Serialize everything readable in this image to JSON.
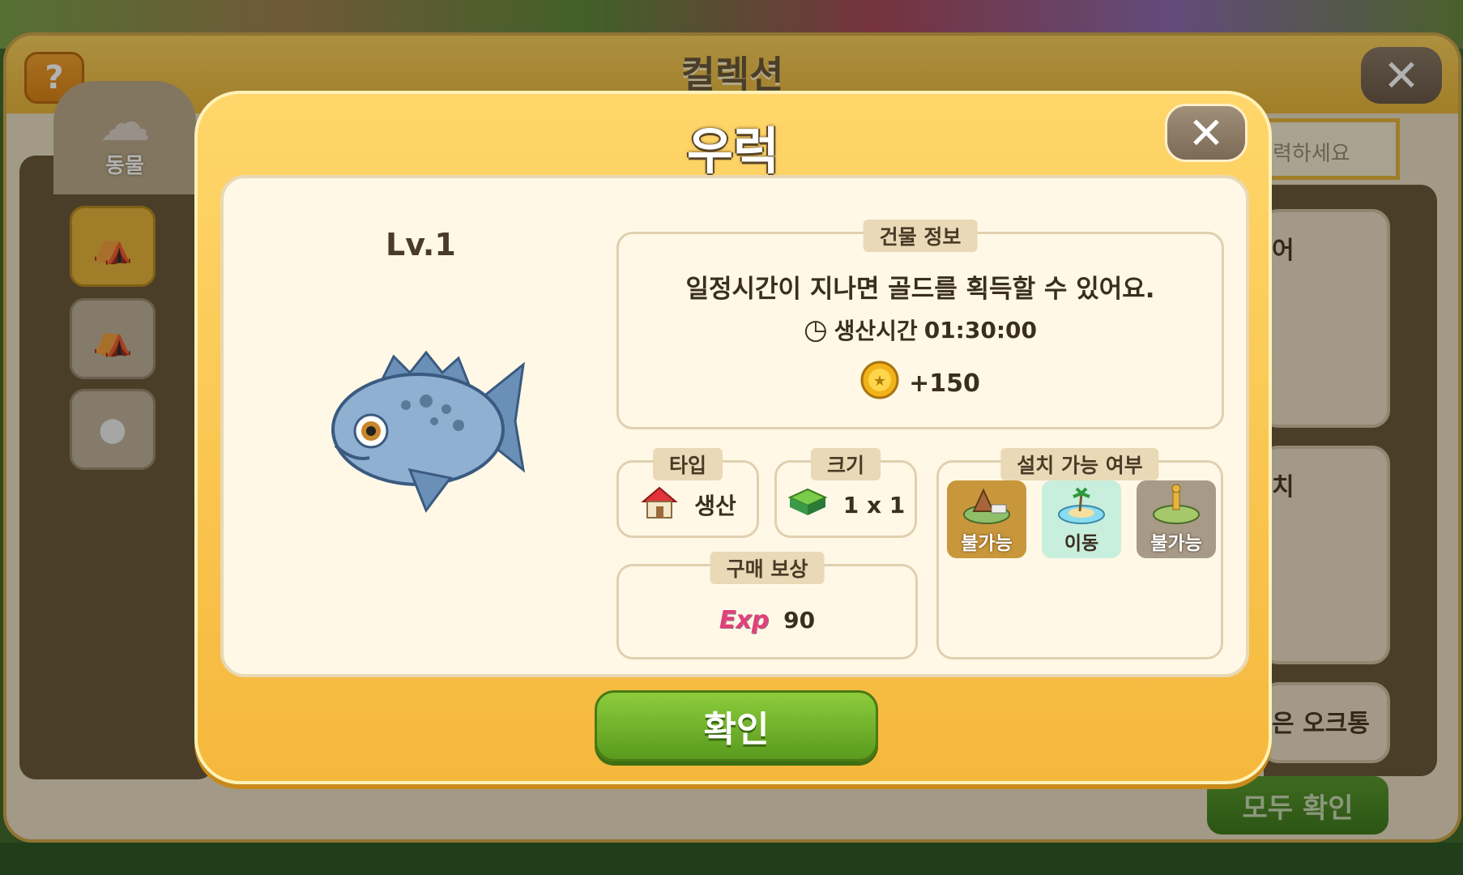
{
  "collection": {
    "title": "컬렉션",
    "help_label": "?",
    "close_label": "✕",
    "side_tab_label": "동물",
    "search_placeholder": "력하세요",
    "right_cards": [
      "어",
      "치",
      "은 오크통"
    ],
    "all_confirm_label": "모두 확인"
  },
  "modal": {
    "title": "우럭",
    "close_label": "✕",
    "level": "Lv.1",
    "building_info": {
      "tag": "건물 정보",
      "description": "일정시간이 지나면 골드를 획득할 수 있어요.",
      "production_time_label": "생산시간",
      "production_time": "01:30:00",
      "gold_reward": "+150"
    },
    "type": {
      "tag": "타입",
      "value": "생산"
    },
    "size": {
      "tag": "크기",
      "value": "1 x 1"
    },
    "purchase_reward": {
      "tag": "구매 보상",
      "exp_label": "Exp",
      "exp_value": "90"
    },
    "placement": {
      "tag": "설치 가능 여부",
      "tiles": [
        {
          "label": "불가능",
          "icon": "farm-tent-icon"
        },
        {
          "label": "이동",
          "icon": "island-icon"
        },
        {
          "label": "불가능",
          "icon": "farm-giraffe-icon"
        }
      ]
    },
    "confirm_label": "확인"
  },
  "colors": {
    "modal_yellow": "#f5b83c",
    "confirm_green": "#5a9a1e",
    "exp_pink": "#e0417a"
  }
}
